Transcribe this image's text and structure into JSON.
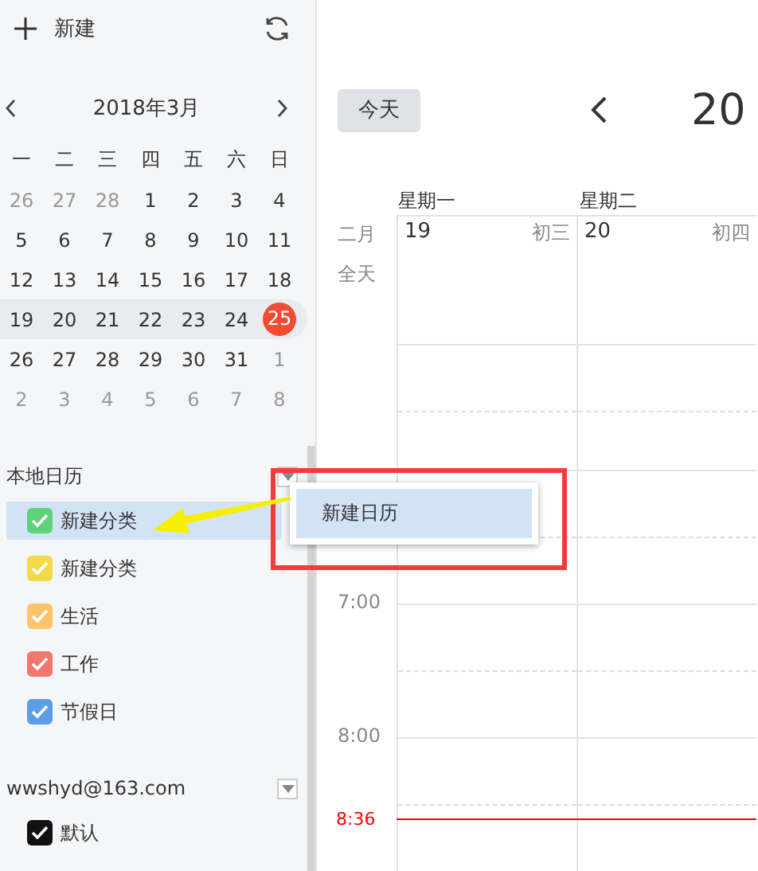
{
  "sidebar": {
    "new_button": "新建",
    "month_title": "2018年3月",
    "weekdays": [
      "一",
      "二",
      "三",
      "四",
      "五",
      "六",
      "日"
    ],
    "weeks": [
      {
        "selected": false,
        "days": [
          {
            "label": "26",
            "muted": true,
            "today": false
          },
          {
            "label": "27",
            "muted": true,
            "today": false
          },
          {
            "label": "28",
            "muted": true,
            "today": false
          },
          {
            "label": "1",
            "muted": false,
            "today": false
          },
          {
            "label": "2",
            "muted": false,
            "today": false
          },
          {
            "label": "3",
            "muted": false,
            "today": false
          },
          {
            "label": "4",
            "muted": false,
            "today": false
          }
        ]
      },
      {
        "selected": false,
        "days": [
          {
            "label": "5",
            "muted": false,
            "today": false
          },
          {
            "label": "6",
            "muted": false,
            "today": false
          },
          {
            "label": "7",
            "muted": false,
            "today": false
          },
          {
            "label": "8",
            "muted": false,
            "today": false
          },
          {
            "label": "9",
            "muted": false,
            "today": false
          },
          {
            "label": "10",
            "muted": false,
            "today": false
          },
          {
            "label": "11",
            "muted": false,
            "today": false
          }
        ]
      },
      {
        "selected": false,
        "days": [
          {
            "label": "12",
            "muted": false,
            "today": false
          },
          {
            "label": "13",
            "muted": false,
            "today": false
          },
          {
            "label": "14",
            "muted": false,
            "today": false
          },
          {
            "label": "15",
            "muted": false,
            "today": false
          },
          {
            "label": "16",
            "muted": false,
            "today": false
          },
          {
            "label": "17",
            "muted": false,
            "today": false
          },
          {
            "label": "18",
            "muted": false,
            "today": false
          }
        ]
      },
      {
        "selected": true,
        "days": [
          {
            "label": "19",
            "muted": false,
            "today": false
          },
          {
            "label": "20",
            "muted": false,
            "today": false
          },
          {
            "label": "21",
            "muted": false,
            "today": false
          },
          {
            "label": "22",
            "muted": false,
            "today": false
          },
          {
            "label": "23",
            "muted": false,
            "today": false
          },
          {
            "label": "24",
            "muted": false,
            "today": false
          },
          {
            "label": "25",
            "muted": false,
            "today": true
          }
        ]
      },
      {
        "selected": false,
        "days": [
          {
            "label": "26",
            "muted": false,
            "today": false
          },
          {
            "label": "27",
            "muted": false,
            "today": false
          },
          {
            "label": "28",
            "muted": false,
            "today": false
          },
          {
            "label": "29",
            "muted": false,
            "today": false
          },
          {
            "label": "30",
            "muted": false,
            "today": false
          },
          {
            "label": "31",
            "muted": false,
            "today": false
          },
          {
            "label": "1",
            "muted": true,
            "today": false
          }
        ]
      },
      {
        "selected": false,
        "days": [
          {
            "label": "2",
            "muted": true,
            "today": false
          },
          {
            "label": "3",
            "muted": true,
            "today": false
          },
          {
            "label": "4",
            "muted": true,
            "today": false
          },
          {
            "label": "5",
            "muted": true,
            "today": false
          },
          {
            "label": "6",
            "muted": true,
            "today": false
          },
          {
            "label": "7",
            "muted": true,
            "today": false
          },
          {
            "label": "8",
            "muted": true,
            "today": false
          }
        ]
      }
    ],
    "sections": [
      {
        "title": "本地日历",
        "items": [
          {
            "label": "新建分类",
            "color": "#5dd27b",
            "checked": true,
            "selected": true
          },
          {
            "label": "新建分类",
            "color": "#f5d949",
            "checked": true,
            "selected": false
          },
          {
            "label": "生活",
            "color": "#fcc56b",
            "checked": true,
            "selected": false
          },
          {
            "label": "工作",
            "color": "#f0776c",
            "checked": true,
            "selected": false
          },
          {
            "label": "节假日",
            "color": "#5c9ee8",
            "checked": true,
            "selected": false
          }
        ]
      },
      {
        "title": "wwshyd@163.com",
        "items": [
          {
            "label": "默认",
            "color": "#111111",
            "checked": true,
            "selected": false
          }
        ]
      }
    ]
  },
  "main": {
    "today_button": "今天",
    "title": "20",
    "days": [
      {
        "weekday": "星期一",
        "date": "19",
        "lunar": "初三"
      },
      {
        "weekday": "星期二",
        "date": "20",
        "lunar": "初四"
      }
    ],
    "allday_labels": [
      "二月",
      "全天"
    ],
    "hours": [
      "7:00",
      "8:00"
    ],
    "now": "8:36"
  },
  "popup_menu": {
    "items": [
      {
        "label": "新建日历",
        "selected": true
      }
    ]
  }
}
